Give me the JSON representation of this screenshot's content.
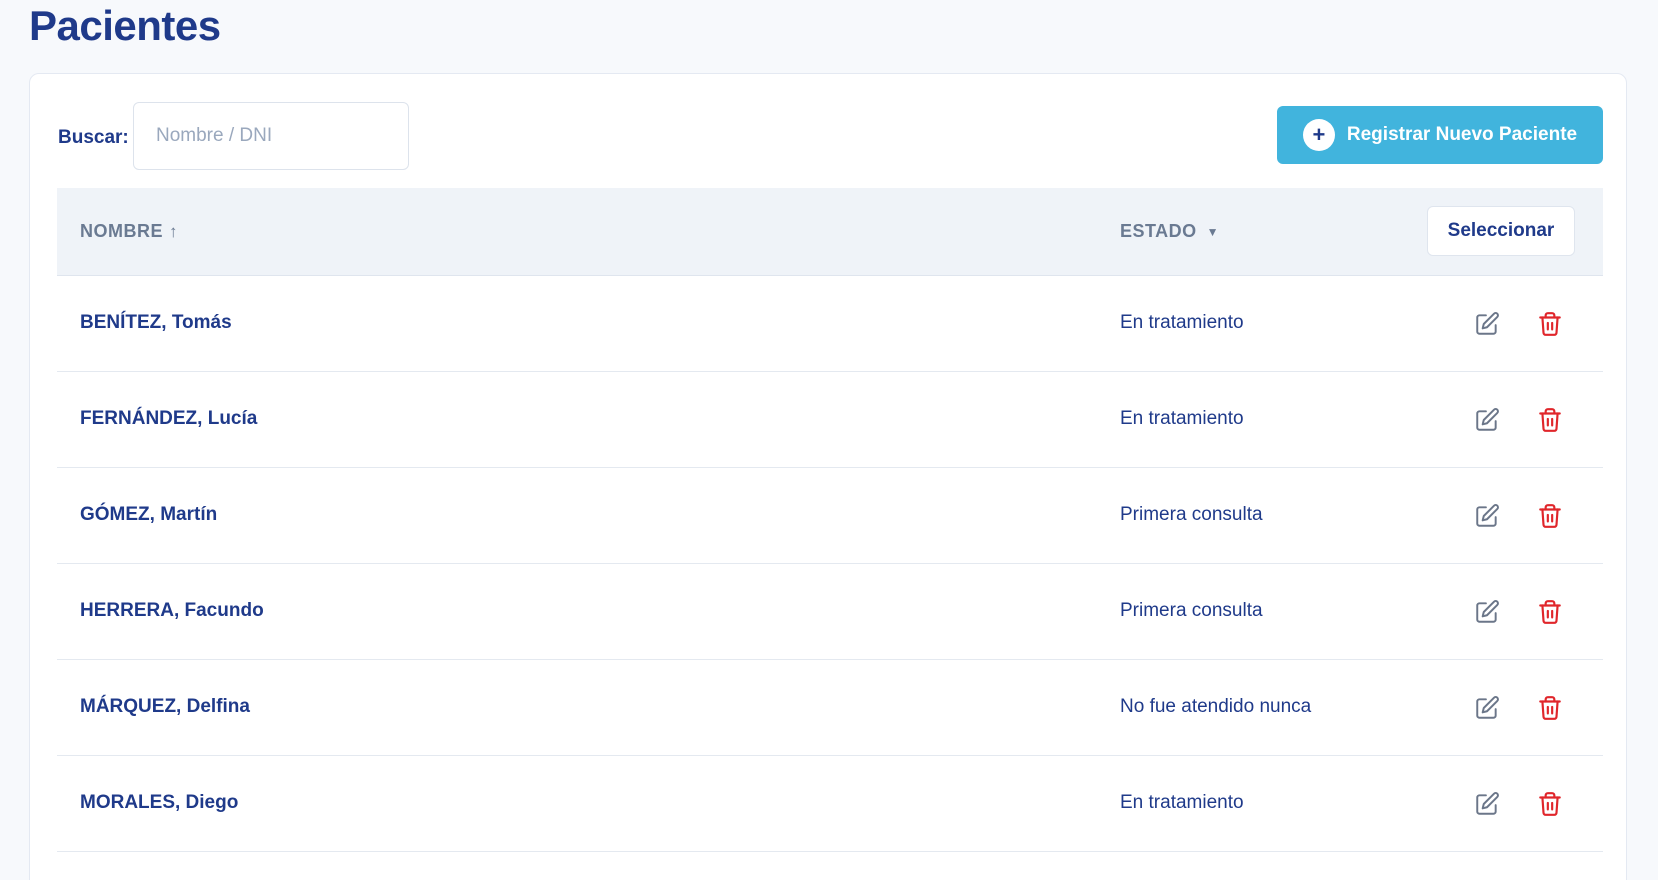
{
  "page": {
    "title": "Pacientes"
  },
  "search": {
    "label": "Buscar:",
    "placeholder": "Nombre / DNI",
    "value": ""
  },
  "actions": {
    "add_label": "Registrar Nuevo Paciente",
    "add_icon": "plus-circle-icon"
  },
  "table": {
    "columns": {
      "name": "NOMBRE",
      "name_sort": "↑",
      "status": "ESTADO",
      "status_caret": "▼"
    },
    "select_label": "Seleccionar",
    "rows": [
      {
        "name": "BENÍTEZ, Tomás",
        "status": "En tratamiento"
      },
      {
        "name": "FERNÁNDEZ, Lucía",
        "status": "En tratamiento"
      },
      {
        "name": "GÓMEZ, Martín",
        "status": "Primera consulta"
      },
      {
        "name": "HERRERA, Facundo",
        "status": "Primera consulta"
      },
      {
        "name": "MÁRQUEZ, Delfina",
        "status": "No fue atendido nunca"
      },
      {
        "name": "MORALES, Diego",
        "status": "En tratamiento"
      }
    ],
    "row_icons": {
      "edit": "edit-icon",
      "delete": "trash-icon"
    }
  },
  "colors": {
    "primary": "#1f3a8a",
    "accent": "#41b4dd",
    "danger": "#e0262b",
    "muted": "#6a7a92"
  }
}
